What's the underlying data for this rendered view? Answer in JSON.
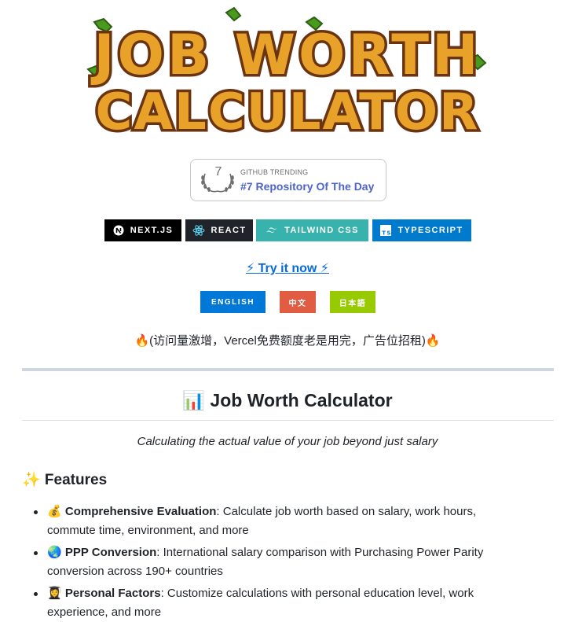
{
  "logo": {
    "line1": "JOB WORTH",
    "line2": "CALCULATOR"
  },
  "trending": {
    "rank": "7",
    "label": "GITHUB TRENDING",
    "title": "#7 Repository Of The Day"
  },
  "tech_badges": [
    {
      "label": "NEXT.JS",
      "color": "#000000",
      "icon": "nextjs-icon"
    },
    {
      "label": "REACT",
      "color": "#20232a",
      "icon": "react-icon"
    },
    {
      "label": "TAILWIND CSS",
      "color": "#38b2ac",
      "icon": "tailwind-icon"
    },
    {
      "label": "TYPESCRIPT",
      "color": "#007acc",
      "icon": "typescript-icon"
    }
  ],
  "try_link": "⚡ Try it now ⚡",
  "languages": [
    {
      "label": "ENGLISH",
      "color": "#0078d7"
    },
    {
      "label": "中文",
      "color": "#e05d44"
    },
    {
      "label": "日本語",
      "color": "#97ca00"
    }
  ],
  "notice": "🔥(访问量激增，Vercel免费额度老是用完，广告位招租)🔥",
  "heading": "📊 Job Worth Calculator",
  "subtitle": "Calculating the actual value of your job beyond just salary",
  "features_heading": "✨ Features",
  "features": [
    {
      "emoji": "💰",
      "title": "Comprehensive Evaluation",
      "text": ": Calculate job worth based on salary, work hours, commute time, environment, and more"
    },
    {
      "emoji": "🌏",
      "title": "PPP Conversion",
      "text": ": International salary comparison with Purchasing Power Parity conversion across 190+ countries"
    },
    {
      "emoji": "👩‍🎓",
      "title": "Personal Factors",
      "text": ": Customize calculations with personal education level, work experience, and more"
    }
  ]
}
